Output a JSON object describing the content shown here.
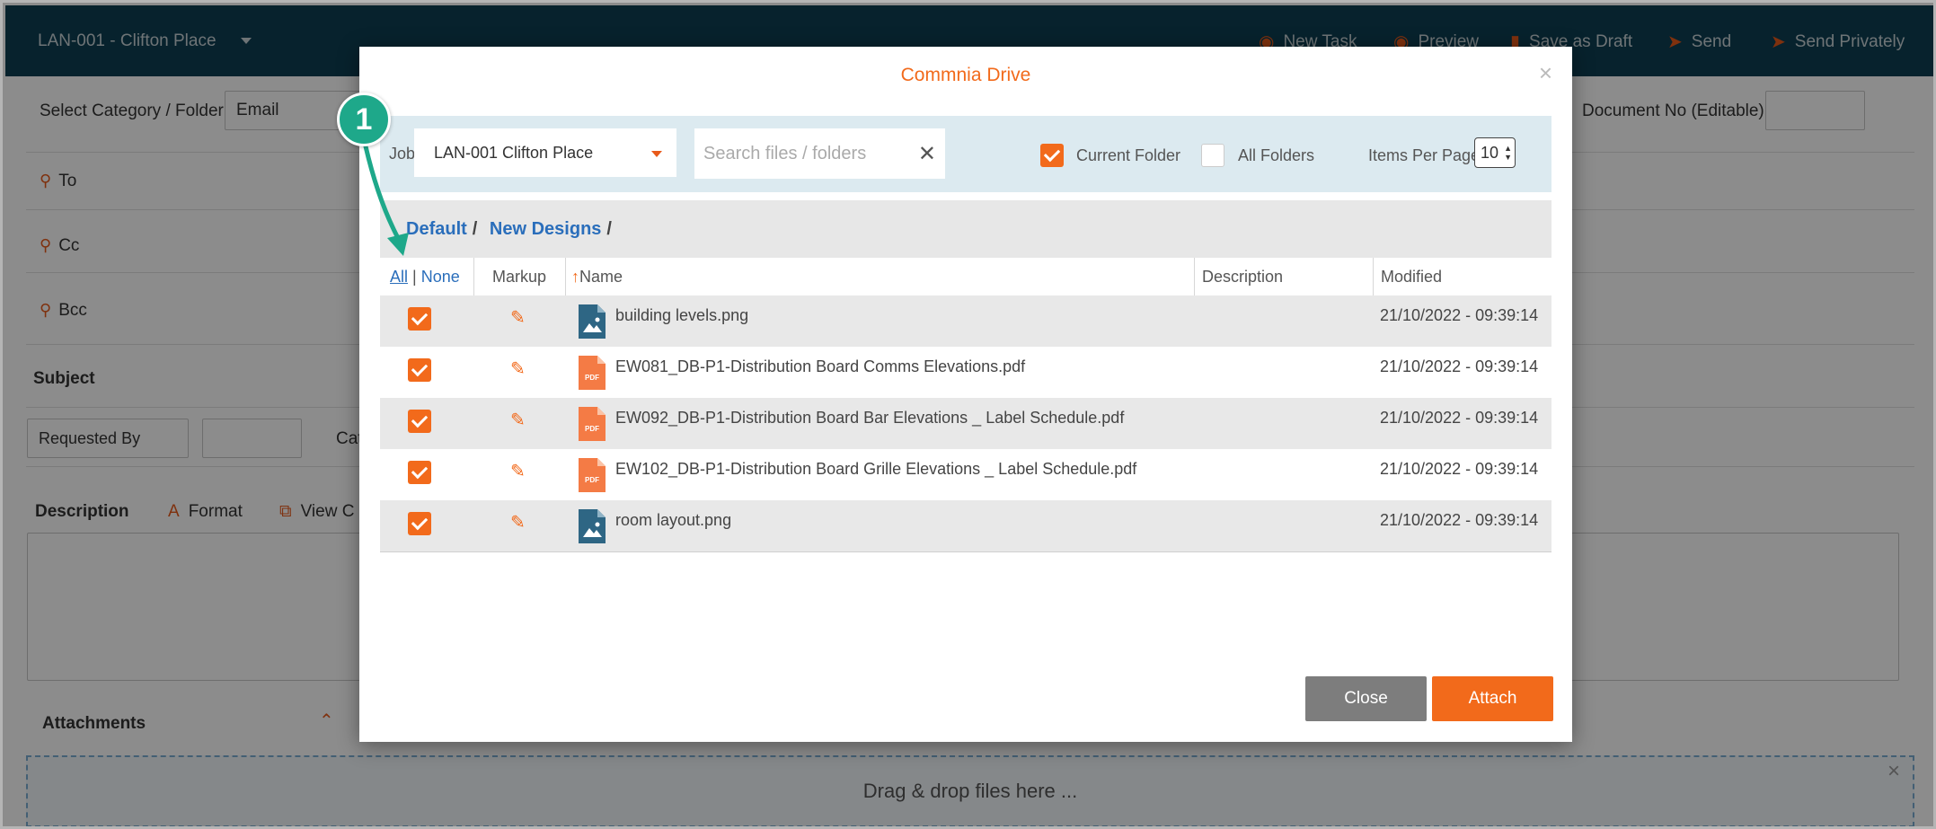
{
  "app": {
    "job_selector": "LAN-001 - Clifton Place",
    "actions": [
      {
        "label": "New Task",
        "icon": "task-icon"
      },
      {
        "label": "Preview",
        "icon": "eye-icon"
      },
      {
        "label": "Save as Draft",
        "icon": "bookmark-icon"
      },
      {
        "label": "Send",
        "icon": "send-icon"
      },
      {
        "label": "Send Privately",
        "icon": "send-private-icon"
      }
    ],
    "category_label": "Select Category / Folder",
    "category_value": "Email",
    "docno_label": "Document No (Editable):",
    "to_label": "To",
    "cc_label": "Cc",
    "bcc_label": "Bcc",
    "subject_label": "Subject",
    "requested_by": "Requested By",
    "cat_partial": "Cat",
    "description_label": "Description",
    "format_label": "Format",
    "view_partial": "View C",
    "attachments_label": "Attachments",
    "dropzone_text": "Drag & drop files here ..."
  },
  "modal": {
    "title": "Commnia Drive",
    "job_label": "Job",
    "job_value": "LAN-001 Clifton Place",
    "search_placeholder": "Search files / folders",
    "current_folder_label": "Current Folder",
    "current_folder_checked": true,
    "all_folders_label": "All Folders",
    "all_folders_checked": false,
    "items_per_page_label": "Items Per Page",
    "items_per_page": "10",
    "breadcrumb": [
      "Default",
      "New Designs"
    ],
    "columns": {
      "all": "All",
      "none": "None",
      "markup": "Markup",
      "name": "Name",
      "description": "Description",
      "modified": "Modified"
    },
    "files": [
      {
        "name": "building levels.png",
        "type": "image",
        "modified": "21/10/2022 - 09:39:14",
        "checked": true
      },
      {
        "name": "EW081_DB-P1-Distribution Board Comms Elevations.pdf",
        "type": "pdf",
        "modified": "21/10/2022 - 09:39:14",
        "checked": true
      },
      {
        "name": "EW092_DB-P1-Distribution Board Bar Elevations _ Label Schedule.pdf",
        "type": "pdf",
        "modified": "21/10/2022 - 09:39:14",
        "checked": true
      },
      {
        "name": "EW102_DB-P1-Distribution Board Grille Elevations _ Label Schedule.pdf",
        "type": "pdf",
        "modified": "21/10/2022 - 09:39:14",
        "checked": true
      },
      {
        "name": "room layout.png",
        "type": "image",
        "modified": "21/10/2022 - 09:39:14",
        "checked": true
      }
    ],
    "close_label": "Close",
    "attach_label": "Attach"
  },
  "annotation": {
    "step": "1"
  },
  "colors": {
    "accent": "#f26a1b",
    "header": "#0d3e52",
    "link": "#2a6ebb",
    "annotation": "#1ea88a"
  }
}
